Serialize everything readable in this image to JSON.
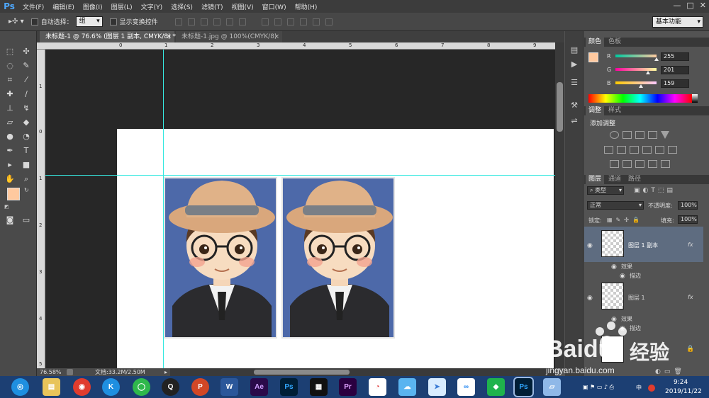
{
  "menubar": {
    "logo": "Ps",
    "items": [
      "文件(F)",
      "编辑(E)",
      "图像(I)",
      "图层(L)",
      "文字(Y)",
      "选择(S)",
      "滤镜(T)",
      "视图(V)",
      "窗口(W)",
      "帮助(H)"
    ]
  },
  "options": {
    "auto_select_label": "自动选择：",
    "auto_select_value": "组",
    "show_transform_label": "显示变换控件",
    "workspace": "基本功能"
  },
  "tabs": [
    {
      "label": "未标题-1 @ 76.6% (图层 1 副本, CMYK/8) *"
    },
    {
      "label": "未标题-1.jpg @ 100%(CMYK/8)"
    }
  ],
  "ruler": {
    "top_ticks": [
      "0",
      "1",
      "2",
      "3",
      "4",
      "5",
      "6",
      "7",
      "8",
      "9"
    ],
    "left_ticks": [
      "1",
      "0",
      "1",
      "2",
      "3",
      "4",
      "5"
    ]
  },
  "status": {
    "zoom": "76.58%",
    "doc": "文档:33.2M/2.50M"
  },
  "color_panel": {
    "tabs": [
      "颜色",
      "色板"
    ],
    "channels": [
      {
        "name": "R",
        "value": "255",
        "fraction": 1.0
      },
      {
        "name": "G",
        "value": "201",
        "fraction": 0.788
      },
      {
        "name": "B",
        "value": "159",
        "fraction": 0.624
      }
    ],
    "foreground": "#ffc99f"
  },
  "adjust_panel": {
    "tabs": [
      "调整",
      "样式"
    ],
    "title": "添加调整"
  },
  "layers_panel": {
    "tabs": [
      "图层",
      "通道",
      "路径"
    ],
    "filter_label": "类型",
    "blend_mode": "正常",
    "opacity_label": "不透明度:",
    "opacity_value": "100%",
    "lock_label": "锁定:",
    "fill_label": "填充:",
    "fill_value": "100%",
    "layers": [
      {
        "name": "图层 1 副本",
        "fx": "fx",
        "effects_label": "效果",
        "stroke_label": "描边"
      },
      {
        "name": "图层 1",
        "fx": "fx",
        "effects_label": "效果",
        "stroke_label": "描边"
      }
    ]
  },
  "taskbar": {
    "apps": [
      "QQ浏览器",
      "文件资源管理器",
      "网易云音乐",
      "酷狗",
      "微信",
      "QQ",
      "PowerPoint",
      "Word",
      "After Effects",
      "Photoshop",
      "剪辑",
      "Premiere",
      "谷歌浏览器",
      "QQ旅游",
      "飞书",
      "百度网盘",
      "绿色应用",
      "Photoshop-active",
      "画图"
    ],
    "time": "9:24",
    "date": "2019/11/22",
    "ime": "中"
  },
  "watermark": {
    "brand": "Baidu",
    "cn": "经验",
    "url": "jingyan.baidu.com"
  }
}
